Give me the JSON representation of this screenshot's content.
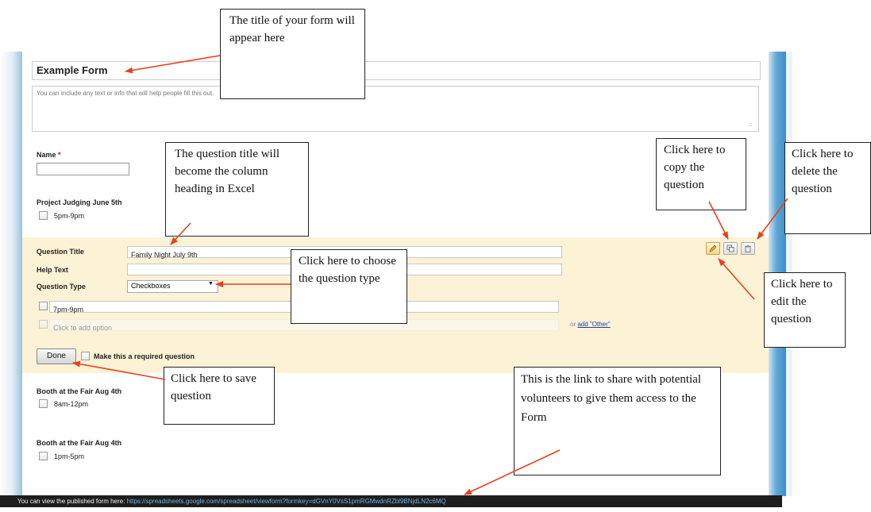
{
  "form": {
    "title": "Example Form",
    "description_placeholder": "You can include any text or info that will help people fill this out.",
    "resize_grip": ".::"
  },
  "questions": {
    "name_label": "Name",
    "required_mark": "*",
    "project_title": "Project Judging June 5th",
    "project_option": "5pm-9pm",
    "booth1_title": "Booth at the Fair Aug 4th",
    "booth1_option": "8am-12pm",
    "booth2_title": "Booth at the Fair Aug 4th",
    "booth2_option": "1pm-5pm"
  },
  "editor": {
    "question_title_label": "Question Title",
    "question_title_value": "Family Night July 9th",
    "help_text_label": "Help Text",
    "help_text_value": "",
    "question_type_label": "Question Type",
    "question_type_value": "Checkboxes",
    "option1": "7pm-9pm",
    "add_option_placeholder": "Click to add option",
    "or_text": "or",
    "add_other_link": "add \"Other\"",
    "done_label": "Done",
    "required_label": "Make this a required question"
  },
  "bottom_bar": {
    "prefix": "You can view the published form here:",
    "url": "https://spreadsheets.google.com/spreadsheet/viewform?formkey=dGVnY0VsS1pmRGMwdnRZbl9BNjdLN2c6MQ"
  },
  "callouts": {
    "title": "The title of your form will appear here",
    "question_title": "The question title will become the column heading in Excel",
    "question_type": "Click here to choose the question type",
    "copy": "Click here to copy the question",
    "delete": "Click here to delete the question",
    "edit": "Click here to edit the question",
    "save": "Click here to save question",
    "link": "This is the link to share with potential volunteers to give them access to the Form"
  },
  "colors": {
    "edit_block_bg": "#fcf2d6",
    "arrow": "#e8401c",
    "bottom_bar": "#1e1e1e"
  },
  "icons": [
    "pencil-icon",
    "copy-icon",
    "trash-icon",
    "dropdown-arrow-icon"
  ]
}
